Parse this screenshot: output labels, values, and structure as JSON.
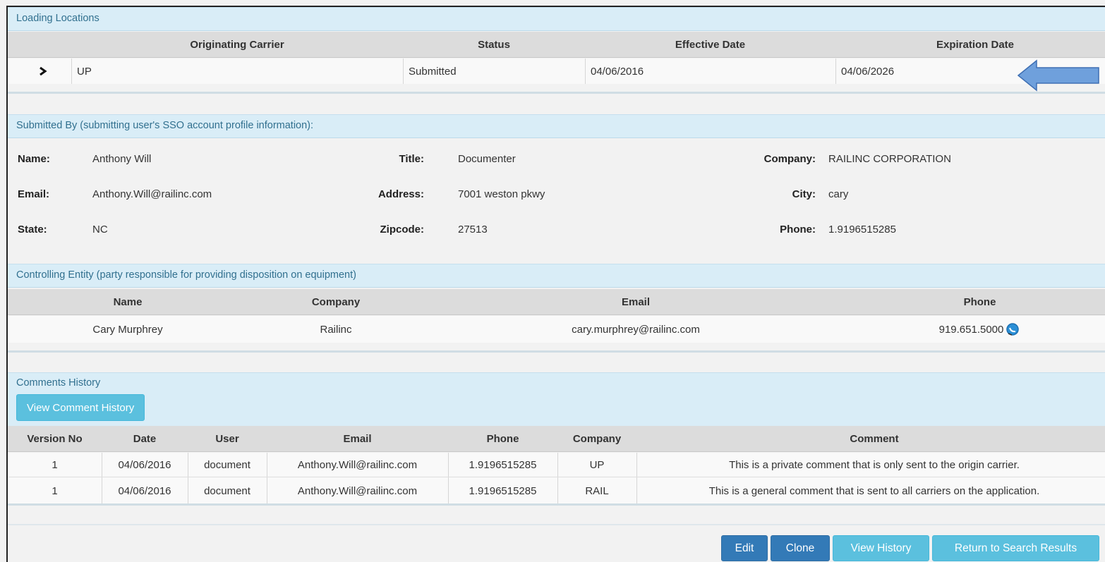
{
  "loading_locations": {
    "title": "Loading Locations",
    "headers": {
      "carrier": "Originating Carrier",
      "status": "Status",
      "effective": "Effective Date",
      "expiration": "Expiration Date"
    },
    "row": {
      "carrier": "UP",
      "status": "Submitted",
      "effective": "04/06/2016",
      "expiration": "04/06/2026"
    }
  },
  "submitted_by": {
    "title": "Submitted By (submitting user's SSO account profile information):",
    "name_label": "Name:",
    "name": "Anthony Will",
    "title_label": "Title:",
    "title_value": "Documenter",
    "company_label": "Company:",
    "company": "RAILINC CORPORATION",
    "email_label": "Email:",
    "email": "Anthony.Will@railinc.com",
    "address_label": "Address:",
    "address": "7001 weston pkwy",
    "city_label": "City:",
    "city": "cary",
    "state_label": "State:",
    "state": "NC",
    "zip_label": "Zipcode:",
    "zip": "27513",
    "phone_label": "Phone:",
    "phone": "1.9196515285"
  },
  "controlling_entity": {
    "title": "Controlling Entity (party responsible for providing disposition on equipment)",
    "headers": {
      "name": "Name",
      "company": "Company",
      "email": "Email",
      "phone": "Phone"
    },
    "row": {
      "name": "Cary Murphrey",
      "company": "Railinc",
      "email": "cary.murphrey@railinc.com",
      "phone": "919.651.5000"
    }
  },
  "comments": {
    "title": "Comments History",
    "view_button": "View Comment History",
    "headers": {
      "version": "Version No",
      "date": "Date",
      "user": "User",
      "email": "Email",
      "phone": "Phone",
      "company": "Company",
      "comment": "Comment"
    },
    "rows": [
      {
        "version": "1",
        "date": "04/06/2016",
        "user": "document",
        "email": "Anthony.Will@railinc.com",
        "phone": "1.9196515285",
        "company": "UP",
        "comment": "This is a private comment that is only sent to the origin carrier."
      },
      {
        "version": "1",
        "date": "04/06/2016",
        "user": "document",
        "email": "Anthony.Will@railinc.com",
        "phone": "1.9196515285",
        "company": "RAIL",
        "comment": "This is a general comment that is sent to all carriers on the application."
      }
    ]
  },
  "actions": {
    "edit": "Edit",
    "clone": "Clone",
    "view_history": "View History",
    "return": "Return to Search Results"
  },
  "colors": {
    "panel_heading": "#d9edf7",
    "panel_text": "#31708f",
    "primary": "#337ab7",
    "info": "#5bc0de",
    "arrow": "#6fa0dc"
  }
}
